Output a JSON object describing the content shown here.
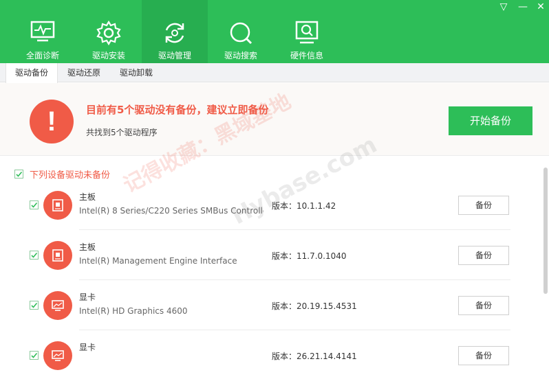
{
  "nav": {
    "items": [
      {
        "label": "全面诊断",
        "icon": "monitor-pulse-icon"
      },
      {
        "label": "驱动安装",
        "icon": "gear-icon"
      },
      {
        "label": "驱动管理",
        "icon": "refresh-gear-icon",
        "active": true
      },
      {
        "label": "驱动搜索",
        "icon": "search-icon"
      },
      {
        "label": "硬件信息",
        "icon": "hardware-search-icon"
      }
    ],
    "window_controls": {
      "menu": "▽",
      "minimize": "—",
      "close": "✕"
    }
  },
  "tabs": [
    {
      "label": "驱动备份",
      "active": true
    },
    {
      "label": "驱动还原"
    },
    {
      "label": "驱动卸载"
    }
  ],
  "banner": {
    "alert_symbol": "!",
    "title": "目前有5个驱动没有备份，建议立即备份",
    "subtitle": "共找到5个驱动程序",
    "start_button": "开始备份"
  },
  "section": {
    "title": "下列设备驱动未备份",
    "checked": true
  },
  "drivers": [
    {
      "category": "主板",
      "name": "Intel(R) 8 Series/C220 Series SMBus Controlle",
      "version": "版本：10.1.1.42",
      "button": "备份",
      "icon": "motherboard-icon",
      "checked": true
    },
    {
      "category": "主板",
      "name": "Intel(R) Management Engine Interface",
      "version": "版本：11.7.0.1040",
      "button": "备份",
      "icon": "motherboard-icon",
      "checked": true
    },
    {
      "category": "显卡",
      "name": "Intel(R) HD Graphics 4600",
      "version": "版本：20.19.15.4531",
      "button": "备份",
      "icon": "display-icon",
      "checked": true
    },
    {
      "category": "显卡",
      "name": "",
      "version": "版本：26.21.14.4141",
      "button": "备份",
      "icon": "display-icon",
      "checked": true
    }
  ],
  "watermark": {
    "line1": "记得收藏：黑域基地",
    "line2": "Hybase.com"
  },
  "colors": {
    "brand_green": "#2dbe58",
    "active_green": "#27ae50",
    "alert_red": "#f05b47"
  }
}
